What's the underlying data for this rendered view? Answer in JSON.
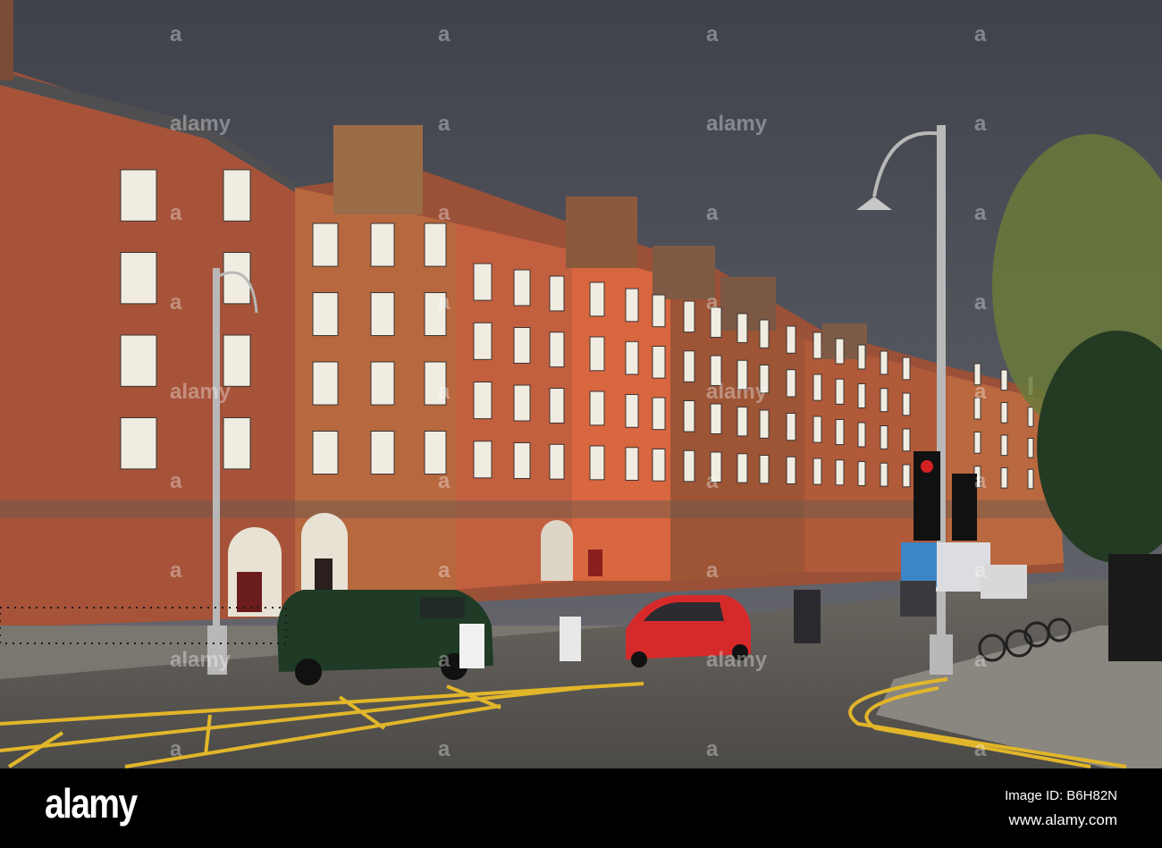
{
  "photo": {
    "subject": "Georgian terraced brick houses on a Dublin street under a dark stormy sky"
  },
  "watermark": {
    "text": "alamy"
  },
  "footer": {
    "logo": "alamy",
    "image_id": "Image ID: B6H82N",
    "website": "www.alamy.com"
  },
  "colors": {
    "sky": "#4b4e57",
    "brick": "#a85a3c",
    "brick_lit": "#d9643f",
    "road": "#55534f",
    "road_line": "#e2b62a"
  }
}
